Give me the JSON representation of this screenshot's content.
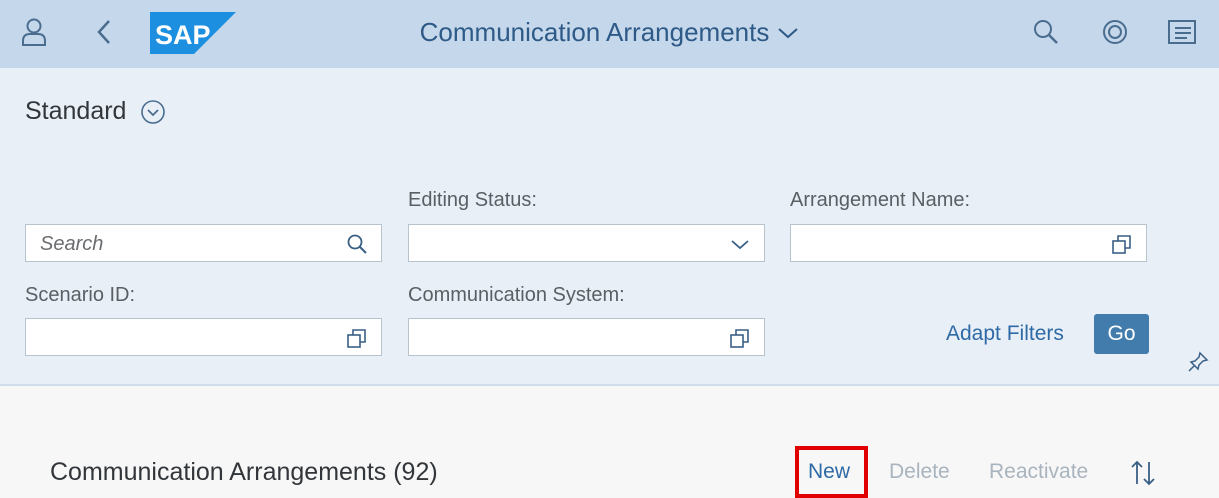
{
  "shell": {
    "title": "Communication Arrangements",
    "icons": [
      "user-icon",
      "back-icon",
      "search-icon",
      "copilot-icon",
      "notifications-icon"
    ],
    "logo_text": "SAP"
  },
  "filterbar": {
    "variant": "Standard",
    "search": {
      "placeholder": "Search"
    },
    "editing_status": {
      "label": "Editing Status:",
      "value": ""
    },
    "arrangement_name": {
      "label": "Arrangement Name:",
      "value": ""
    },
    "scenario_id": {
      "label": "Scenario ID:",
      "value": ""
    },
    "communication_system": {
      "label": "Communication System:",
      "value": ""
    },
    "adapt_filters": "Adapt Filters",
    "go": "Go"
  },
  "table": {
    "title": "Communication Arrangements (92)",
    "new": "New",
    "delete": "Delete",
    "reactivate": "Reactivate"
  },
  "colors": {
    "shell_bg": "#c5d7ea",
    "header_bg": "#e8eff7",
    "accent": "#427cac",
    "highlight": "#e00000"
  }
}
